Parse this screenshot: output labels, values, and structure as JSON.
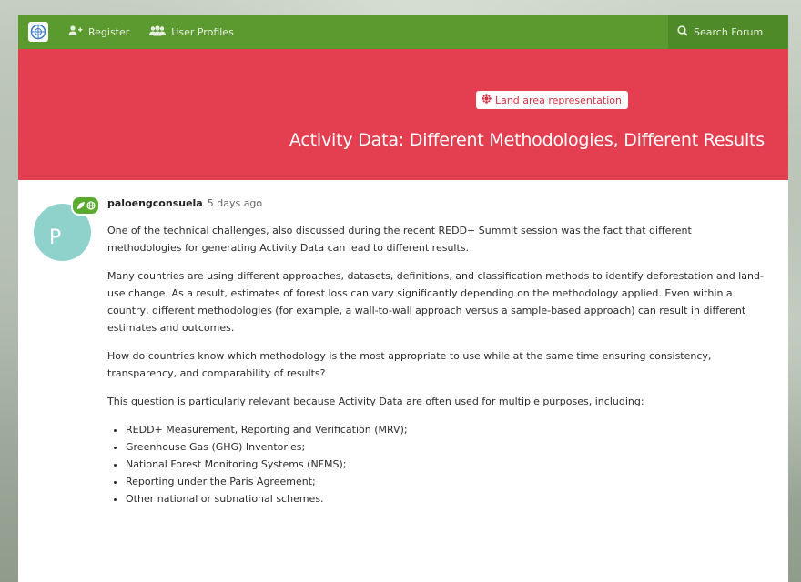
{
  "nav": {
    "register_label": "Register",
    "user_profiles_label": "User Profiles",
    "search_placeholder": "Search Forum"
  },
  "hero": {
    "tag_label": "Land area representation",
    "title": "Activity Data: Different Methodologies, Different Results"
  },
  "colors": {
    "navbar": "#5a9a2e",
    "hero": "#e43f50",
    "avatar": "#8fd2cc"
  },
  "post": {
    "avatar_letter": "P",
    "author": "paloengconsuela",
    "time": "5 days ago",
    "paragraphs": [
      "One of the technical challenges, also discussed during the recent REDD+ Summit session was the fact that different methodologies for generating Activity Data can lead to different results.",
      "Many countries are using different approaches, datasets, definitions, and classification methods to identify deforestation and land-use change. As a result, estimates of forest loss can vary significantly depending on the methodology applied. Even within a country, different methodologies (for example, a wall-to-wall approach versus a sample-based approach) can result in different estimates and outcomes.",
      "How do countries know which methodology is the most appropriate to use while at the same time ensuring consistency, transparency, and comparability of results?",
      "This question is particularly relevant because Activity Data are often used for multiple purposes, including:"
    ],
    "list": [
      "REDD+ Measurement, Reporting and Verification (MRV);",
      "Greenhouse Gas (GHG) Inventories;",
      "National Forest Monitoring Systems (NFMS);",
      "Reporting under the Paris Agreement;",
      "Other national or subnational schemes."
    ]
  }
}
